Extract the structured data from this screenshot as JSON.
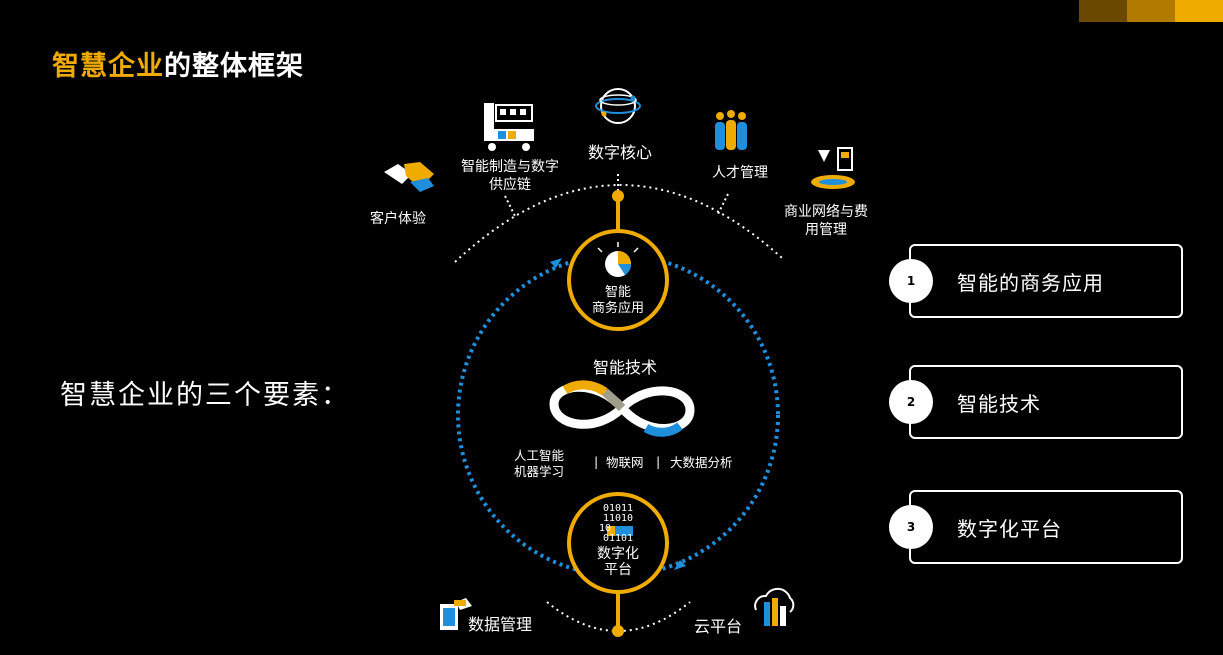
{
  "title": {
    "highlight": "智慧企业",
    "rest": "的整体框架"
  },
  "subtitle": "智慧企业的三个要素：",
  "colors": {
    "accent": "#f0ab00",
    "blue": "#1f8fdb",
    "bar1": "#6b4a00",
    "bar2": "#b27a00",
    "bar3": "#f0ab00"
  },
  "top_apps": [
    {
      "label": "客户体验",
      "icon": "handshake-icon"
    },
    {
      "label": "智能制造与数字供应链",
      "icon": "factory-icon"
    },
    {
      "label": "数字核心",
      "icon": "digital-core-icon"
    },
    {
      "label": "人才管理",
      "icon": "people-icon"
    },
    {
      "label": "商业网络与费用管理",
      "icon": "network-icon"
    }
  ],
  "circle_top": {
    "line1": "智能",
    "line2": "商务应用",
    "icon": "brain-bulb-icon"
  },
  "tech": {
    "title": "智能技术",
    "icon": "infinity-icon",
    "items": [
      "人工智能机器学习",
      "物联网",
      "大数据分析"
    ],
    "ai_line1": "人工智能",
    "ai_line2": "机器学习",
    "sep": "|"
  },
  "circle_bottom": {
    "line1": "数字化",
    "line2": "平台",
    "binary": [
      "01011",
      "11010",
      "10",
      "01101"
    ],
    "icon": "binary-icon"
  },
  "bottom_items": [
    {
      "label": "数据管理",
      "icon": "data-management-icon"
    },
    {
      "label": "云平台",
      "icon": "cloud-icon"
    }
  ],
  "cards": [
    {
      "num": "1",
      "text": "智能的商务应用"
    },
    {
      "num": "2",
      "text": "智能技术"
    },
    {
      "num": "3",
      "text": "数字化平台"
    }
  ]
}
